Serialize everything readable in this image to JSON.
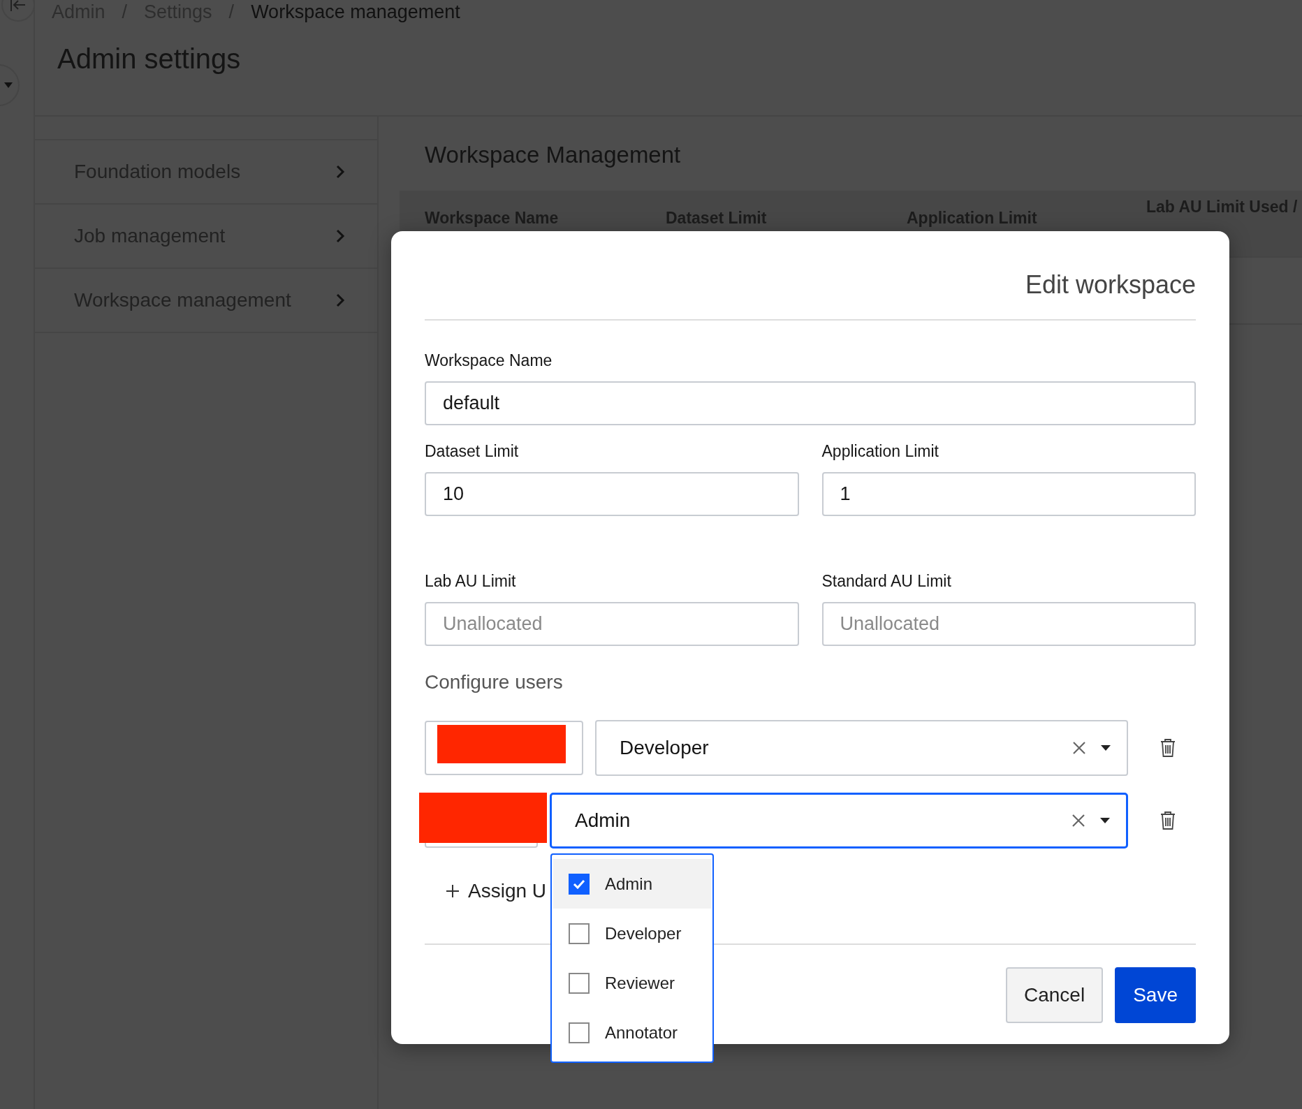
{
  "breadcrumb": {
    "separator": "/",
    "items": [
      {
        "label": "Admin",
        "current": false
      },
      {
        "label": "Settings",
        "current": false
      },
      {
        "label": "Workspace management",
        "current": true
      }
    ]
  },
  "page_title": "Admin settings",
  "sidebar": {
    "items": [
      {
        "label": "Foundation models"
      },
      {
        "label": "Job management"
      },
      {
        "label": "Workspace management"
      }
    ]
  },
  "main": {
    "title": "Workspace Management",
    "table": {
      "columns": [
        "Workspace Name",
        "Dataset Limit",
        "Application Limit",
        "Lab AU Limit Used /"
      ]
    }
  },
  "dialog": {
    "title": "Edit workspace",
    "fields": [
      {
        "label": "Workspace Name",
        "value": "default"
      },
      {
        "label": "Dataset Limit",
        "value": "10"
      },
      {
        "label": "Application Limit",
        "value": "1"
      },
      {
        "label": "Lab AU Limit",
        "placeholder": "Unallocated"
      },
      {
        "label": "Standard AU Limit",
        "placeholder": "Unallocated"
      }
    ],
    "section_title": "Configure users",
    "users": [
      {
        "role": "Developer",
        "focused": false
      },
      {
        "role": "Admin",
        "focused": true
      }
    ],
    "assign_button": "Assign U",
    "role_menu": {
      "options": [
        {
          "label": "Admin",
          "checked": true,
          "selected": true
        },
        {
          "label": "Developer",
          "checked": false,
          "selected": false
        },
        {
          "label": "Reviewer",
          "checked": false,
          "selected": false
        },
        {
          "label": "Annotator",
          "checked": false,
          "selected": false
        }
      ]
    },
    "buttons": [
      {
        "label": "Cancel",
        "kind": "secondary"
      },
      {
        "label": "Save",
        "kind": "primary"
      }
    ]
  }
}
